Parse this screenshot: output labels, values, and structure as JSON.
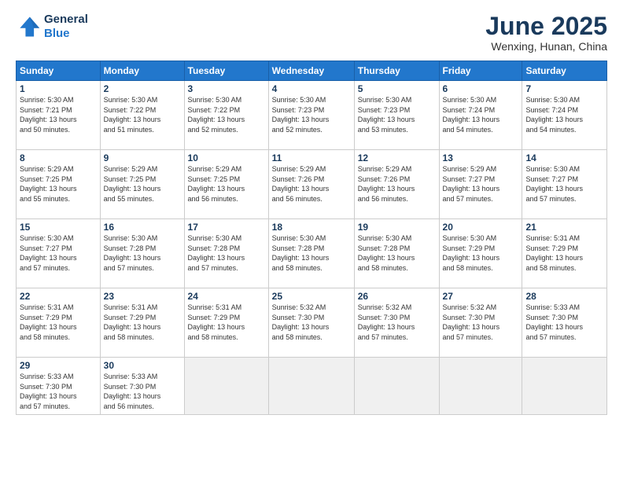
{
  "header": {
    "logo_line1": "General",
    "logo_line2": "Blue",
    "month_title": "June 2025",
    "subtitle": "Wenxing, Hunan, China"
  },
  "weekdays": [
    "Sunday",
    "Monday",
    "Tuesday",
    "Wednesday",
    "Thursday",
    "Friday",
    "Saturday"
  ],
  "weeks": [
    [
      {
        "day": "1",
        "info": "Sunrise: 5:30 AM\nSunset: 7:21 PM\nDaylight: 13 hours\nand 50 minutes."
      },
      {
        "day": "2",
        "info": "Sunrise: 5:30 AM\nSunset: 7:22 PM\nDaylight: 13 hours\nand 51 minutes."
      },
      {
        "day": "3",
        "info": "Sunrise: 5:30 AM\nSunset: 7:22 PM\nDaylight: 13 hours\nand 52 minutes."
      },
      {
        "day": "4",
        "info": "Sunrise: 5:30 AM\nSunset: 7:23 PM\nDaylight: 13 hours\nand 52 minutes."
      },
      {
        "day": "5",
        "info": "Sunrise: 5:30 AM\nSunset: 7:23 PM\nDaylight: 13 hours\nand 53 minutes."
      },
      {
        "day": "6",
        "info": "Sunrise: 5:30 AM\nSunset: 7:24 PM\nDaylight: 13 hours\nand 54 minutes."
      },
      {
        "day": "7",
        "info": "Sunrise: 5:30 AM\nSunset: 7:24 PM\nDaylight: 13 hours\nand 54 minutes."
      }
    ],
    [
      {
        "day": "8",
        "info": "Sunrise: 5:29 AM\nSunset: 7:25 PM\nDaylight: 13 hours\nand 55 minutes."
      },
      {
        "day": "9",
        "info": "Sunrise: 5:29 AM\nSunset: 7:25 PM\nDaylight: 13 hours\nand 55 minutes."
      },
      {
        "day": "10",
        "info": "Sunrise: 5:29 AM\nSunset: 7:25 PM\nDaylight: 13 hours\nand 56 minutes."
      },
      {
        "day": "11",
        "info": "Sunrise: 5:29 AM\nSunset: 7:26 PM\nDaylight: 13 hours\nand 56 minutes."
      },
      {
        "day": "12",
        "info": "Sunrise: 5:29 AM\nSunset: 7:26 PM\nDaylight: 13 hours\nand 56 minutes."
      },
      {
        "day": "13",
        "info": "Sunrise: 5:29 AM\nSunset: 7:27 PM\nDaylight: 13 hours\nand 57 minutes."
      },
      {
        "day": "14",
        "info": "Sunrise: 5:30 AM\nSunset: 7:27 PM\nDaylight: 13 hours\nand 57 minutes."
      }
    ],
    [
      {
        "day": "15",
        "info": "Sunrise: 5:30 AM\nSunset: 7:27 PM\nDaylight: 13 hours\nand 57 minutes."
      },
      {
        "day": "16",
        "info": "Sunrise: 5:30 AM\nSunset: 7:28 PM\nDaylight: 13 hours\nand 57 minutes."
      },
      {
        "day": "17",
        "info": "Sunrise: 5:30 AM\nSunset: 7:28 PM\nDaylight: 13 hours\nand 57 minutes."
      },
      {
        "day": "18",
        "info": "Sunrise: 5:30 AM\nSunset: 7:28 PM\nDaylight: 13 hours\nand 58 minutes."
      },
      {
        "day": "19",
        "info": "Sunrise: 5:30 AM\nSunset: 7:28 PM\nDaylight: 13 hours\nand 58 minutes."
      },
      {
        "day": "20",
        "info": "Sunrise: 5:30 AM\nSunset: 7:29 PM\nDaylight: 13 hours\nand 58 minutes."
      },
      {
        "day": "21",
        "info": "Sunrise: 5:31 AM\nSunset: 7:29 PM\nDaylight: 13 hours\nand 58 minutes."
      }
    ],
    [
      {
        "day": "22",
        "info": "Sunrise: 5:31 AM\nSunset: 7:29 PM\nDaylight: 13 hours\nand 58 minutes."
      },
      {
        "day": "23",
        "info": "Sunrise: 5:31 AM\nSunset: 7:29 PM\nDaylight: 13 hours\nand 58 minutes."
      },
      {
        "day": "24",
        "info": "Sunrise: 5:31 AM\nSunset: 7:29 PM\nDaylight: 13 hours\nand 58 minutes."
      },
      {
        "day": "25",
        "info": "Sunrise: 5:32 AM\nSunset: 7:30 PM\nDaylight: 13 hours\nand 58 minutes."
      },
      {
        "day": "26",
        "info": "Sunrise: 5:32 AM\nSunset: 7:30 PM\nDaylight: 13 hours\nand 57 minutes."
      },
      {
        "day": "27",
        "info": "Sunrise: 5:32 AM\nSunset: 7:30 PM\nDaylight: 13 hours\nand 57 minutes."
      },
      {
        "day": "28",
        "info": "Sunrise: 5:33 AM\nSunset: 7:30 PM\nDaylight: 13 hours\nand 57 minutes."
      }
    ],
    [
      {
        "day": "29",
        "info": "Sunrise: 5:33 AM\nSunset: 7:30 PM\nDaylight: 13 hours\nand 57 minutes."
      },
      {
        "day": "30",
        "info": "Sunrise: 5:33 AM\nSunset: 7:30 PM\nDaylight: 13 hours\nand 56 minutes."
      },
      {
        "day": "",
        "info": ""
      },
      {
        "day": "",
        "info": ""
      },
      {
        "day": "",
        "info": ""
      },
      {
        "day": "",
        "info": ""
      },
      {
        "day": "",
        "info": ""
      }
    ]
  ]
}
